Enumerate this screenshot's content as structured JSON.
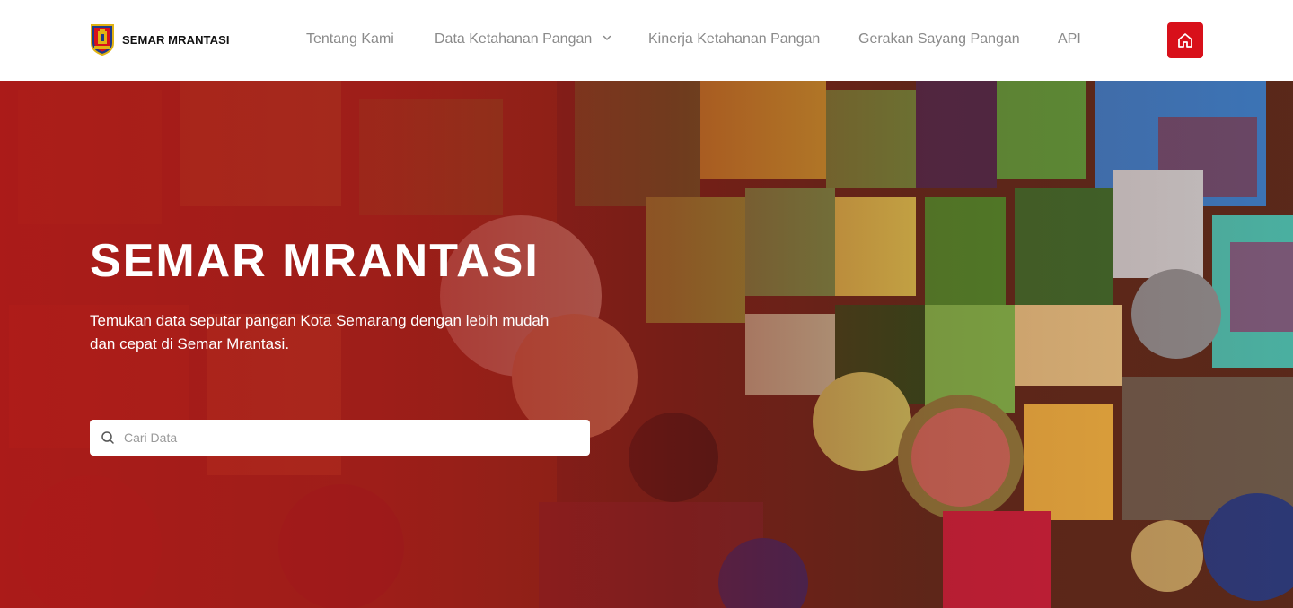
{
  "brand": {
    "name": "SEMAR MRANTASI",
    "logo_icon": "city-shield-logo"
  },
  "nav": {
    "items": [
      {
        "label": "Tentang Kami"
      },
      {
        "label": "Data Ketahanan Pangan",
        "has_dropdown": true
      },
      {
        "label": "Kinerja Ketahanan Pangan"
      },
      {
        "label": "Gerakan Sayang Pangan"
      },
      {
        "label": "API"
      }
    ],
    "home_icon": "home-icon"
  },
  "hero": {
    "title": "SEMAR MRANTASI",
    "subtitle": "Temukan data seputar pangan Kota Semarang dengan lebih mudah dan cepat di Semar Mrantasi.",
    "background_image": "market-vegetables-overhead"
  },
  "search": {
    "placeholder": "Cari Data",
    "value": "",
    "icon": "search-icon"
  },
  "colors": {
    "accent": "#d8101a",
    "nav_text": "#8a8a8a",
    "hero_overlay": "#a81919"
  }
}
